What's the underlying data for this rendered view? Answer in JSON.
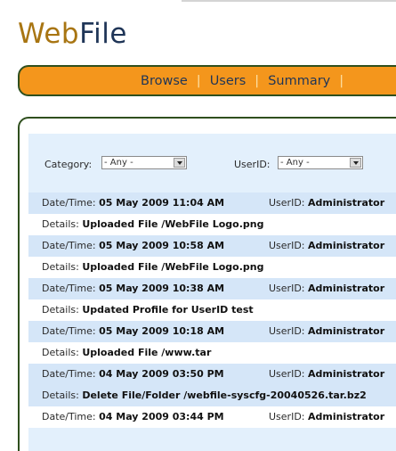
{
  "logo": {
    "part1": "Web",
    "part2": "File"
  },
  "nav": [
    {
      "label": "Browse"
    },
    {
      "label": "Users"
    },
    {
      "label": "Summary"
    }
  ],
  "nav_separator": "|",
  "filters": {
    "category_label": "Category:",
    "category_value": "- Any -",
    "userid_label": "UserID:",
    "userid_value": "- Any -"
  },
  "labels": {
    "datetime": "Date/Time:",
    "userid": "UserID:",
    "details": "Details:"
  },
  "entries": [
    {
      "datetime": "05 May 2009 11:04 AM",
      "userid": "Administrator",
      "details": "Uploaded File /WebFile Logo.png"
    },
    {
      "datetime": "05 May 2009 10:58 AM",
      "userid": "Administrator",
      "details": "Uploaded File /WebFile Logo.png"
    },
    {
      "datetime": "05 May 2009 10:38 AM",
      "userid": "Administrator",
      "details": "Updated Profile for UserID test"
    },
    {
      "datetime": "05 May 2009 10:18 AM",
      "userid": "Administrator",
      "details": "Uploaded File /www.tar"
    },
    {
      "datetime": "04 May 2009 03:50 PM",
      "userid": "Administrator",
      "details": "Delete File/Folder /webfile-syscfg-20040526.tar.bz2"
    },
    {
      "datetime": "04 May 2009 03:44 PM",
      "userid": "Administrator",
      "details": ""
    }
  ],
  "colors": {
    "nav_orange": "#f4961c",
    "frame_green": "#2f4f1e",
    "content_blue": "#e3f0fc",
    "row_blue": "#d5e6f8",
    "logo_gold": "#a87512",
    "logo_navy": "#1f3557"
  }
}
